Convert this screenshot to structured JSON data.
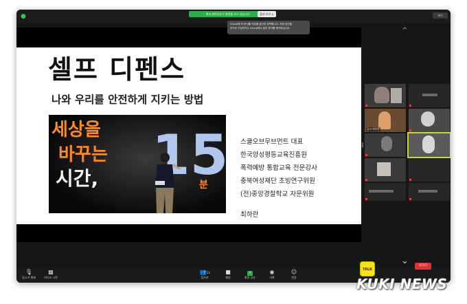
{
  "topbar": {
    "share_banner": "회의 화면공유가 화면을 보고 있습니다.",
    "options_label": "옵션 보기 ∨",
    "view_label": "보기"
  },
  "icloud_tip": {
    "line1": "iCloud에 이 문서를 저장할 공간이 부족합니다. 저장 공간을",
    "line2": "추가로 구입하거나 iCloud에서 일부 문서를 제거하십시오."
  },
  "slide": {
    "title": "셀프 디펜스",
    "subtitle": "나와 우리를 안전하게 지키는 방법",
    "photo_text": {
      "line1": "세상을",
      "line2": "바꾸는",
      "line3": "시간,",
      "number": "15",
      "unit": "분"
    },
    "info_lines": [
      "스쿨오브무브먼트 대표",
      "한국양성평등교육진흥원",
      "폭력예방 통합교육 전문강사",
      "충북여성재단 초빙연구위원",
      "(전)중앙경찰학교 자문위원"
    ],
    "name": "최하란"
  },
  "gallery": {
    "label_1": "김사 최하란"
  },
  "toolbar": {
    "audio_label": "음소거 해제",
    "video_label": "비디오 시작",
    "participants_label": "참가자",
    "participants_count": "13",
    "chat_label": "채팅",
    "share_label": "화면 공유",
    "record_label": "기록",
    "reactions_label": "반응",
    "leave_label": "나가기"
  },
  "kakao_label": "TALK",
  "watermark": "KUKI NEWS",
  "colors": {
    "share_green": "#2dae4c",
    "leave_red": "#e0322f",
    "active_speaker": "#c9d442",
    "kakao_yellow": "#f7e21a",
    "photo_text_orange": "#ff8a1e",
    "photo_number_blue": "#bcd6ff"
  }
}
